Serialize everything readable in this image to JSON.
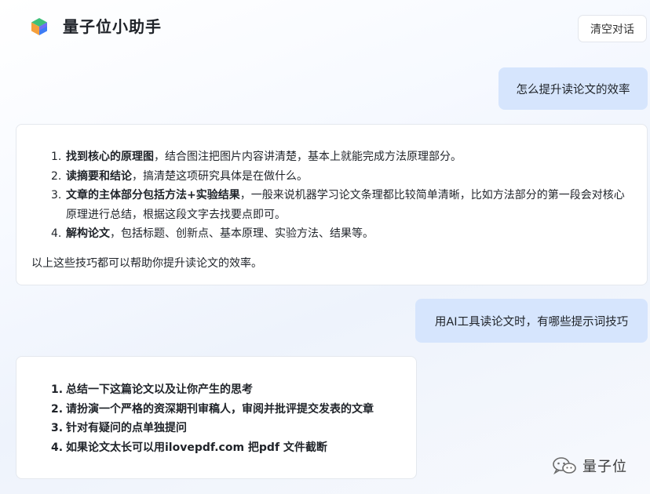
{
  "header": {
    "title": "量子位小助手",
    "clear_button": "清空对话"
  },
  "messages": [
    {
      "role": "user",
      "text": "怎么提升读论文的效率"
    },
    {
      "role": "assistant",
      "items": [
        {
          "num": "1.",
          "bold": "找到核心的原理图",
          "text": "，结合图注把图片内容讲清楚，基本上就能完成方法原理部分。"
        },
        {
          "num": "2.",
          "bold": "读摘要和结论",
          "text": "，搞清楚这项研究具体是在做什么。"
        },
        {
          "num": "3.",
          "bold": "文章的主体部分包括方法+实验结果",
          "text": "，一般来说机器学习论文条理都比较简单清晰，比如方法部分的第一段会对核心原理进行总结，根据这段文字去找要点即可。"
        },
        {
          "num": "4.",
          "bold": "解构论文",
          "text": "，包括标题、创新点、基本原理、实验方法、结果等。"
        }
      ],
      "summary": "以上这些技巧都可以帮助你提升读论文的效率。"
    },
    {
      "role": "user",
      "text": "用AI工具读论文时，有哪些提示词技巧"
    },
    {
      "role": "assistant",
      "items": [
        {
          "num": "1.",
          "text": "总结一下这篇论文以及让你产生的思考"
        },
        {
          "num": "2.",
          "text": "请扮演一个严格的资深期刊审稿人，审阅并批评提交发表的文章"
        },
        {
          "num": "3.",
          "text": "针对有疑问的点单独提问"
        },
        {
          "num": "4.",
          "text": "如果论文太长可以用ilovepdf.com 把pdf 文件截断"
        }
      ]
    }
  ],
  "watermark": {
    "text": "量子位",
    "icon": "wechat-icon"
  },
  "colors": {
    "user_bubble": "#d6e5fd",
    "card_border": "#e4e8ee",
    "logo_green": "#3fc07a",
    "logo_blue": "#3d7cf5",
    "logo_purple": "#9a63f0",
    "logo_orange": "#f5a03d"
  }
}
